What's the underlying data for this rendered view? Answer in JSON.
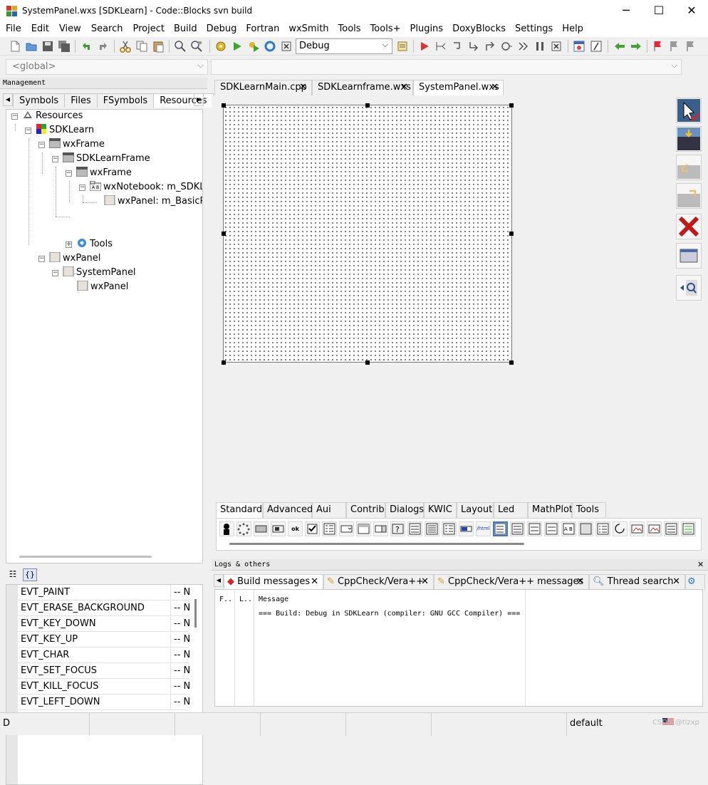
{
  "window": {
    "title": "SystemPanel.wxs [SDKLearn] - Code::Blocks svn build",
    "minimize": "─",
    "maximize": "☐",
    "close": "✕"
  },
  "menu": [
    "File",
    "Edit",
    "View",
    "Search",
    "Project",
    "Build",
    "Debug",
    "Fortran",
    "wxSmith",
    "Tools",
    "Tools+",
    "Plugins",
    "DoxyBlocks",
    "Settings",
    "Help"
  ],
  "toolbar": {
    "build_target": "Debug"
  },
  "code_completion": {
    "scope": "<global>",
    "symbol": ""
  },
  "management": {
    "caption": "Management",
    "tabs": [
      "Symbols",
      "Files",
      "FSymbols",
      "Resources"
    ],
    "active_tab": "Resources",
    "tree": [
      {
        "label": "Resources"
      },
      {
        "label": "SDKLearn"
      },
      {
        "label": "wxFrame"
      },
      {
        "label": "SDKLearnFrame"
      },
      {
        "label": "wxFrame"
      },
      {
        "label": "wxNotebook: m_SDKLe"
      },
      {
        "label": "wxPanel: m_BasicPag"
      },
      {
        "label": "Tools"
      },
      {
        "label": "wxPanel"
      },
      {
        "label": "SystemPanel"
      },
      {
        "label": "wxPanel"
      }
    ],
    "events": [
      {
        "name": "EVT_PAINT",
        "value": "-- N"
      },
      {
        "name": "EVT_ERASE_BACKGROUND",
        "value": "-- N"
      },
      {
        "name": "EVT_KEY_DOWN",
        "value": "-- N"
      },
      {
        "name": "EVT_KEY_UP",
        "value": "-- N"
      },
      {
        "name": "EVT_CHAR",
        "value": "-- N"
      },
      {
        "name": "EVT_SET_FOCUS",
        "value": "-- N"
      },
      {
        "name": "EVT_KILL_FOCUS",
        "value": "-- N"
      },
      {
        "name": "EVT_LEFT_DOWN",
        "value": "-- N"
      }
    ],
    "events_toggle": "{}"
  },
  "editor": {
    "tabs": [
      "SDKLearnMain.cpp",
      "SDKLearnframe.wxs",
      "SystemPanel.wxs"
    ],
    "active_tab": "SystemPanel.wxs",
    "close": "✕"
  },
  "palette": {
    "tabs": [
      "Standard",
      "Advanced",
      "Aui",
      "Contrib",
      "Dialogs",
      "KWIC",
      "Layout",
      "Led",
      "MathPlot",
      "Tools"
    ],
    "active_tab": "Standard",
    "icons": [
      "ok",
      "/html"
    ]
  },
  "logs": {
    "caption": "Logs & others",
    "tabs": [
      "Build messages",
      "CppCheck/Vera++",
      "CppCheck/Vera++ messages",
      "Thread search"
    ],
    "active_tab": "Build messages",
    "columns": [
      "F..",
      "L..",
      "Message"
    ],
    "rows": [
      {
        "file": "",
        "line": "",
        "message": "=== Build: Debug in SDKLearn (compiler: GNU GCC Compiler) ==="
      }
    ]
  },
  "statusbar": {
    "left": "D",
    "profile": "default",
    "watermark": "CSDN @tlzxp"
  }
}
